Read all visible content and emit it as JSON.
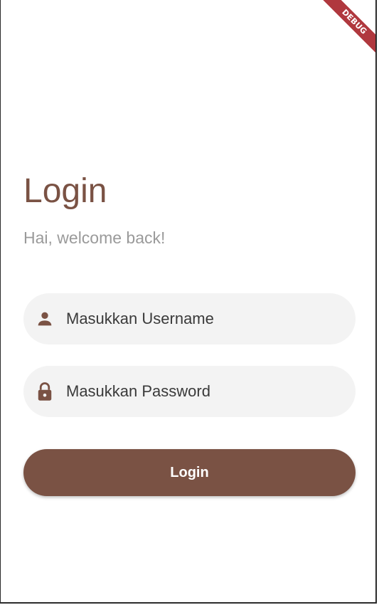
{
  "debug_banner": {
    "label": "DEBUG",
    "color": "#b0383e"
  },
  "header": {
    "title": "Login",
    "subtitle": "Hai, welcome back!"
  },
  "form": {
    "username": {
      "placeholder": "Masukkan Username",
      "value": "",
      "icon": "person-icon"
    },
    "password": {
      "placeholder": "Masukkan Password",
      "value": "",
      "icon": "lock-icon"
    },
    "submit_label": "Login"
  },
  "colors": {
    "brand": "#7a5244",
    "muted_text": "#9a9a9a",
    "field_background": "#f3f3f3"
  }
}
